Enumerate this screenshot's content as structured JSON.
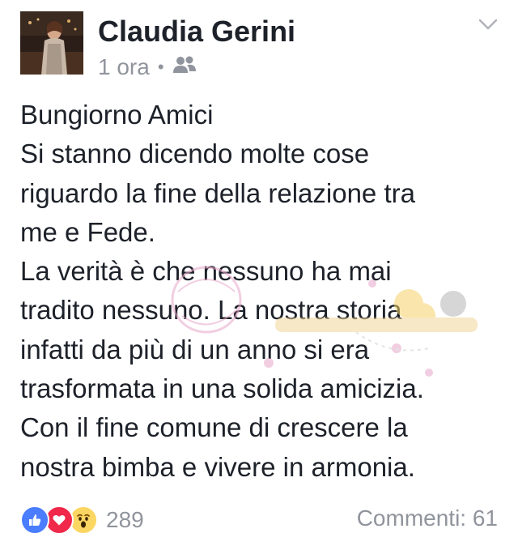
{
  "post": {
    "author": "Claudia Gerini",
    "time": "1 ora",
    "separator": "•",
    "audience_icon": "friends-icon",
    "menu_icon": "chevron-down-icon",
    "text": "Bungiorno Amici\nSi stanno dicendo molte cose\nriguardo la fine della relazione tra\nme e Fede.\nLa verità è che nessuno ha mai\ntradito nessuno. La nostra storia\ninfatti da più di un anno si era\ntrasformata in una solida amicizia.\nCon il fine comune di crescere la\nnostra bimba e vivere in armonia."
  },
  "footer": {
    "reaction_icons": [
      "like-icon",
      "love-icon",
      "wow-icon"
    ],
    "reaction_count": "289",
    "comments": "Commenti: 61"
  },
  "colors": {
    "text": "#1d2129",
    "muted": "#90949c",
    "like": "#4a7dff",
    "love": "#f0284a",
    "wow": "#fcd662"
  }
}
